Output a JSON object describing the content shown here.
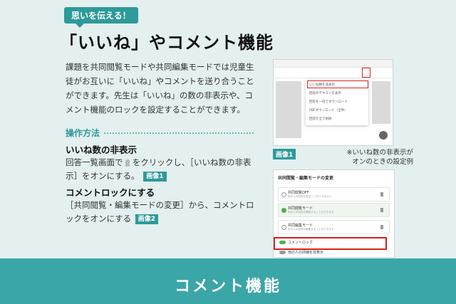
{
  "tagline": "思いを伝える！",
  "title": "「いいね」やコメント機能",
  "intro": "課題を共同閲覧モードや共同編集モードでは児童生徒がお互いに「いいね」やコメントを送り合うことができます。先生は「いいね」の数の非表示や、コメント機能のロックを設定することができます。",
  "how_label": "操作方法",
  "section1": {
    "heading": "いいね数の非表示",
    "text_a": "回答一覧画面で",
    "text_b": "をクリックし、［いいね数の非表示］をオンにする。",
    "badge": "画像1"
  },
  "section2": {
    "heading": "コメントロックにする",
    "text": "［共同閲覧・編集モードの変更］から、コメントロックをオンにする",
    "badge": "画像2"
  },
  "image1": {
    "label": "画像1",
    "note_line1": "※いいね数の非表示が",
    "note_line2": "オンのときの設定例",
    "menu_items": [
      "いいね数を非表示",
      "回答のテキストを表示",
      "回答を一括でダウンロード",
      "PDFダウンロード（全件）",
      "回答を全て削除"
    ]
  },
  "image2": {
    "header": "共同閲覧・編集モードの変更",
    "options": [
      {
        "title": "共同閲覧OFF",
        "sub": "他の人の回答を見ることができません"
      },
      {
        "title": "共同閲覧モード",
        "sub": "他の人の回答を閲覧することができます"
      },
      {
        "title": "共同編集モード",
        "sub": "他の人の回答を編集することができます"
      }
    ],
    "comment_lock": "コメントロック",
    "extra": "他の人の評価を非表示"
  },
  "footer": "コメント機能",
  "colors": {
    "accent": "#2e9a9a",
    "footer": "#3aa6a8",
    "highlight": "#d62020"
  }
}
